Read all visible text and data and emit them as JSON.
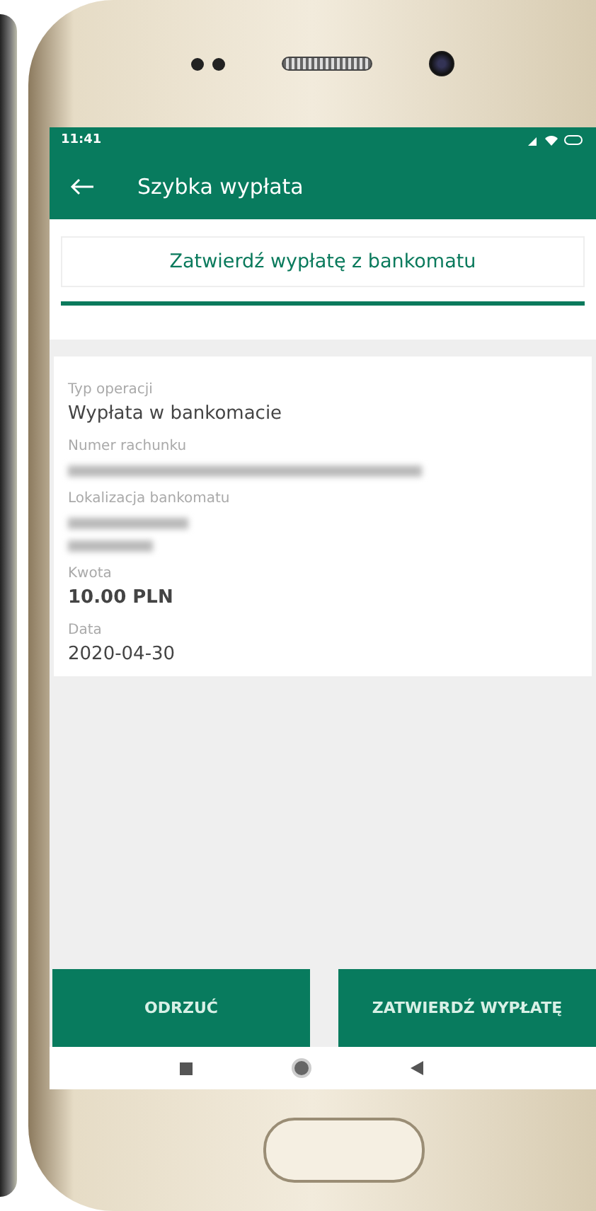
{
  "status_bar": {
    "time": "11:41"
  },
  "app_bar": {
    "title": "Szybka wypłata"
  },
  "header": {
    "title": "Zatwierdź wypłatę z bankomatu"
  },
  "details": [
    {
      "label": "Typ operacji",
      "value": "Wypłata w bankomacie",
      "kind": "text"
    },
    {
      "label": "Numer rachunku",
      "kind": "masked"
    },
    {
      "label": "Lokalizacja bankomatu",
      "kind": "masked_address"
    },
    {
      "label": "Kwota",
      "value": "10.00 PLN",
      "kind": "bold"
    },
    {
      "label": "Data",
      "value": "2020-04-30",
      "kind": "text"
    }
  ],
  "buttons": [
    {
      "label": "ODRZUĆ"
    },
    {
      "label": "ZATWIERDŹ WYPŁATĘ"
    }
  ]
}
